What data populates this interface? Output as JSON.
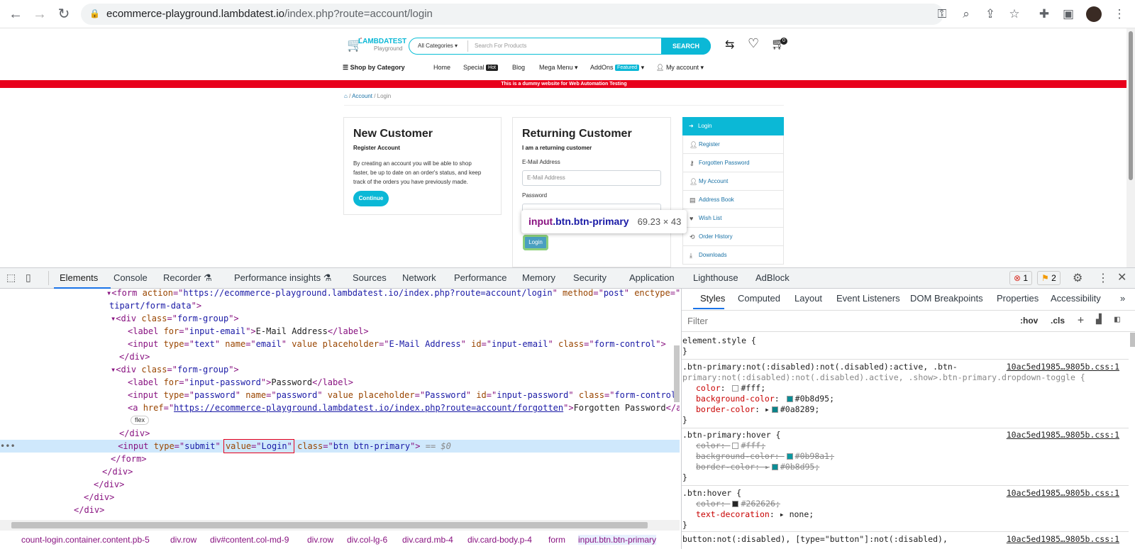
{
  "browser": {
    "url_host": "ecommerce-playground.lambdatest.io",
    "url_path": "/index.php?route=account/login"
  },
  "site": {
    "logo_main": "LAMBDATEST",
    "logo_sub": "Playground",
    "search": {
      "category": "All Categories",
      "placeholder": "Search For Products",
      "button": "SEARCH"
    },
    "cart_count": "0",
    "shop_by_category": "Shop by Category",
    "menu": {
      "home": "Home",
      "special": "Special",
      "special_badge": "Hot",
      "blog": "Blog",
      "mega_menu": "Mega Menu",
      "addons": "AddOns",
      "addons_badge": "Featured",
      "my_account": "My account"
    },
    "notice": "This is a dummy website for Web Automation Testing",
    "breadcrumb": {
      "account": "Account",
      "login": "Login"
    },
    "new_customer": {
      "title": "New Customer",
      "subtitle": "Register Account",
      "text1": "By creating an account you will be able to shop",
      "text2": "faster, be up to date on an order's status, and keep",
      "text3": "track of the orders you have previously made.",
      "button": "Continue"
    },
    "returning": {
      "title": "Returning Customer",
      "subtitle": "I am a returning customer",
      "email_label": "E-Mail Address",
      "email_placeholder": "E-Mail Address",
      "password_label": "Password",
      "login_button": "Login"
    },
    "sidebar": [
      "Login",
      "Register",
      "Forgotten Password",
      "My Account",
      "Address Book",
      "Wish List",
      "Order History",
      "Downloads"
    ],
    "tooltip": {
      "tag": "input",
      "cls": ".btn.btn-primary",
      "size": "69.23 × 43"
    }
  },
  "devtools": {
    "tabs": [
      "Elements",
      "Console",
      "Recorder",
      "Performance insights",
      "Sources",
      "Network",
      "Performance",
      "Memory",
      "Security",
      "Application",
      "Lighthouse",
      "AdBlock"
    ],
    "errors": "1",
    "warnings": "2",
    "styles_tabs": [
      "Styles",
      "Computed",
      "Layout",
      "Event Listeners",
      "DOM Breakpoints",
      "Properties",
      "Accessibility"
    ],
    "filter_placeholder": "Filter",
    "hov": ":hov",
    "cls": ".cls",
    "crumbs": [
      "count-login.container.content.pb-5",
      "div.row",
      "div#content.col-md-9",
      "div.row",
      "div.col-lg-6",
      "div.card.mb-4",
      "div.card-body.p-4",
      "form",
      "input.btn.btn-primary"
    ],
    "styles": {
      "element_style": "element.style {",
      "rule1_sel": ".btn-primary:not(:disabled):not(.disabled):active, .btn-",
      "rule1_sel2": "primary:not(:disabled):not(.disabled).active, .show>.btn-primary.dropdown-toggle {",
      "rule1_src": "10ac5ed1985…9805b.css:1",
      "r1_color": "#fff",
      "r1_bg": "#0b8d95",
      "r1_border": "#0a8289",
      "rule2_sel": ".btn-primary:hover {",
      "r2_color": "#fff",
      "r2_bg": "#0b98a1",
      "r2_border": "#0b8d95",
      "rule3_sel": ".btn:hover {",
      "r3_color": "#262626",
      "r3_td": "none",
      "rule4_sel": "button:not(:disabled), [type=\"button\"]:not(:disabled),"
    }
  }
}
